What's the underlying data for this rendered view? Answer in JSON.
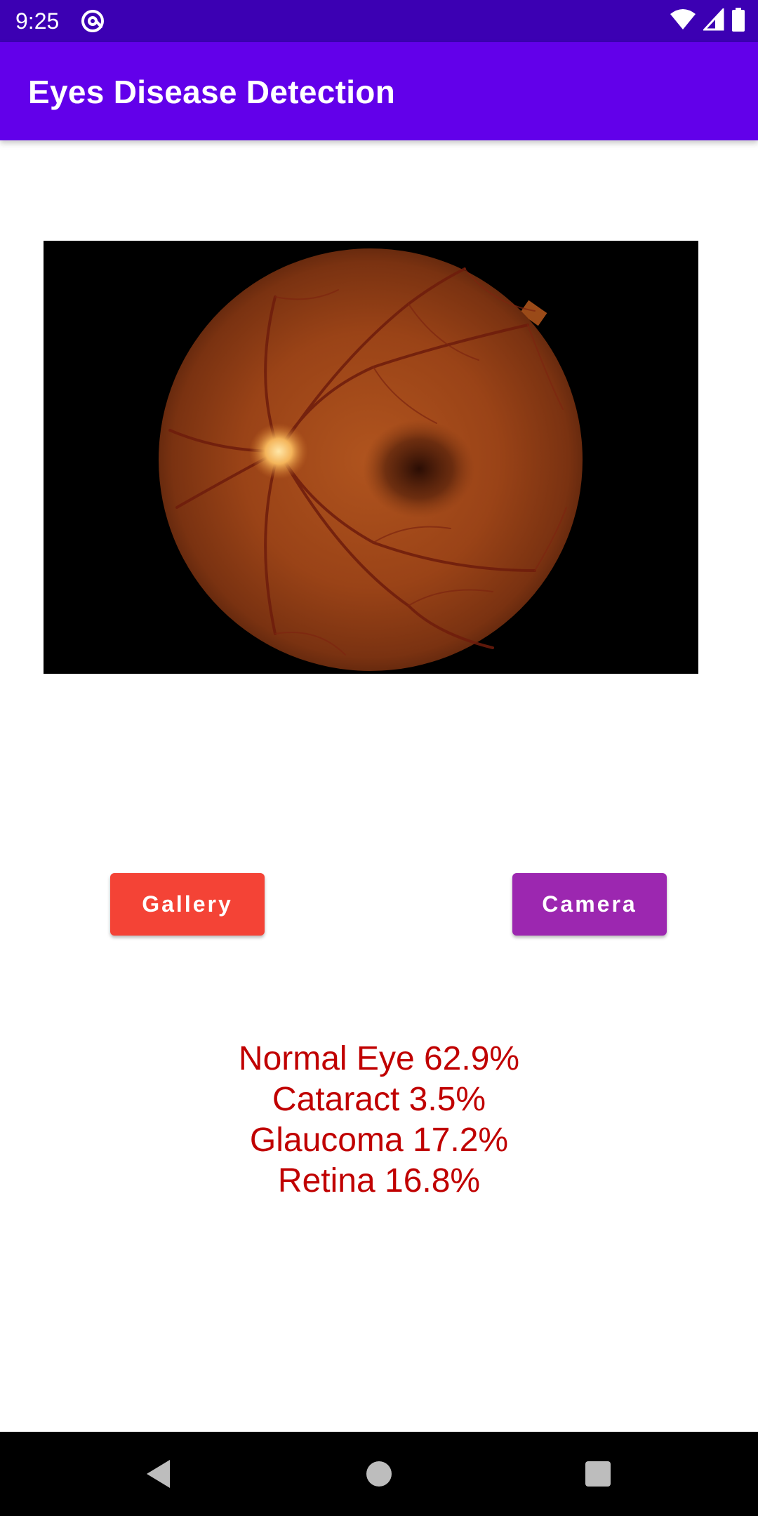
{
  "status_bar": {
    "time": "9:25",
    "app_icon": "at-sign-icon",
    "icons": [
      "wifi-icon",
      "cell-signal-icon",
      "battery-icon"
    ],
    "background": "#3c00b3"
  },
  "app_bar": {
    "title": "Eyes Disease Detection",
    "background": "#6200ea"
  },
  "image": {
    "subject": "retinal fundus photograph",
    "background": "#000000"
  },
  "buttons": {
    "gallery_label": "Gallery",
    "gallery_color": "#f44336",
    "camera_label": "Camera",
    "camera_color": "#9c27b0"
  },
  "results": {
    "color": "#c00000",
    "lines": [
      "Normal Eye 62.9%",
      "Cataract 3.5%",
      "Glaucoma 17.2%",
      "Retina 16.8%"
    ]
  },
  "nav_bar": {
    "icons": [
      "back-icon",
      "home-icon",
      "recents-icon"
    ]
  }
}
